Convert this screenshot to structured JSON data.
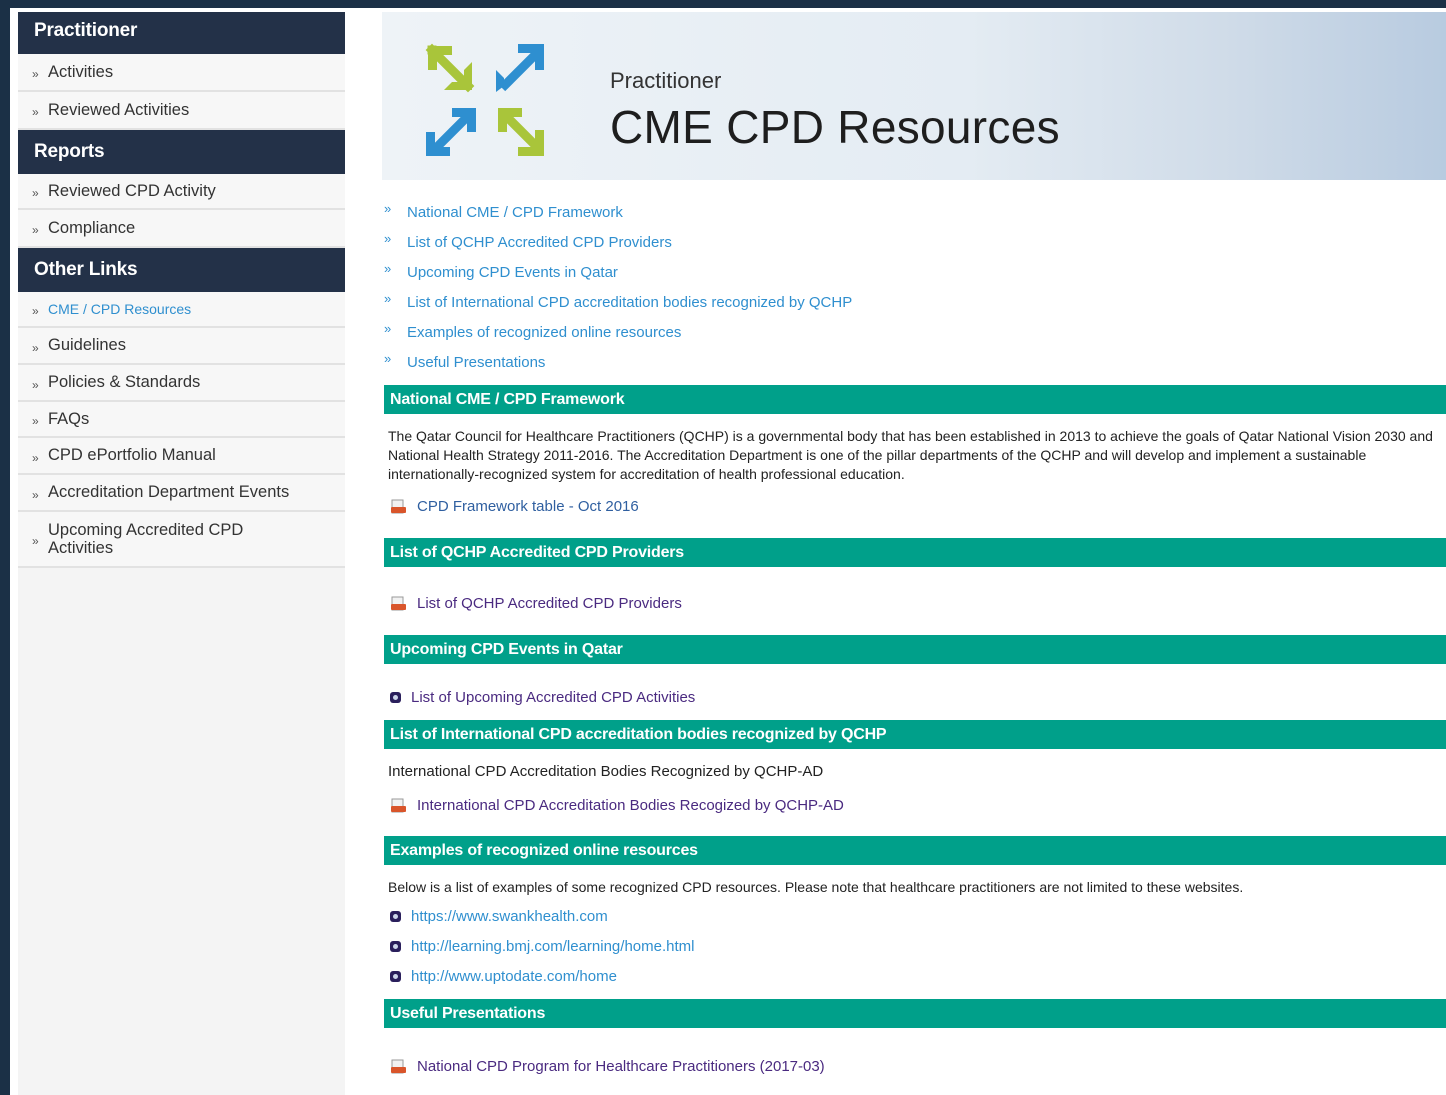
{
  "sidebar": {
    "sections": [
      {
        "heading": "Practitioner",
        "items": [
          "Activities",
          "Reviewed Activities"
        ]
      },
      {
        "heading": "Reports",
        "items": [
          "Reviewed CPD Activity",
          "Compliance"
        ]
      },
      {
        "heading": "Other Links",
        "items": [
          "CME / CPD Resources",
          "Guidelines",
          "Policies & Standards",
          "FAQs",
          "CPD ePortfolio Manual",
          "Accreditation Department Events",
          "Upcoming Accredited CPD Activities"
        ]
      }
    ],
    "bullet": "»"
  },
  "banner": {
    "subtitle": "Practitioner",
    "title": "CME CPD Resources"
  },
  "toc": [
    "National CME / CPD Framework",
    "List of QCHP Accredited CPD Providers",
    "Upcoming CPD Events in Qatar",
    "List of International CPD accreditation bodies recognized by QCHP",
    "Examples of recognized online resources",
    "Useful Presentations"
  ],
  "sections": {
    "framework": {
      "heading": "National CME / CPD Framework",
      "text": "The Qatar Council for Healthcare Practitioners (QCHP) is a governmental body that has been established in 2013 to achieve the goals of Qatar National Vision 2030 and National Health Strategy 2011-2016. The Accreditation Department is one of the pillar departments of the QCHP and will develop and implement a sustainable internationally-recognized system for accreditation of health professional education.",
      "link": "CPD Framework table - Oct 2016"
    },
    "providers": {
      "heading": "List of QCHP Accredited CPD Providers",
      "link": "List of QCHP Accredited CPD Providers"
    },
    "events": {
      "heading": "Upcoming CPD Events in Qatar",
      "link": "List of Upcoming Accredited CPD Activities"
    },
    "international": {
      "heading": "List of International CPD accreditation bodies recognized by QCHP",
      "text": "International CPD Accreditation Bodies Recognized by QCHP-AD",
      "link": "International CPD Accreditation Bodies Recogized by QCHP-AD"
    },
    "online": {
      "heading": "Examples of recognized online resources",
      "text": "Below is a list of examples of some recognized CPD resources. Please note that healthcare practitioners are not limited to these websites.",
      "links": [
        "https://www.swankhealth.com",
        "http://learning.bmj.com/learning/home.html",
        "http://www.uptodate.com/home"
      ]
    },
    "presentations": {
      "heading": "Useful Presentations",
      "link": "National CPD Program for Healthcare Practitioners (2017-03)"
    }
  },
  "colors": {
    "sidebar_heading": "#233148",
    "section_heading": "#00a08a",
    "link_blue": "#2f8fcf",
    "link_purple": "#4a2a80"
  },
  "icons": [
    "arrows-logo-icon",
    "pdf-document-icon",
    "bullet-square-icon",
    "double-chevron-icon"
  ]
}
